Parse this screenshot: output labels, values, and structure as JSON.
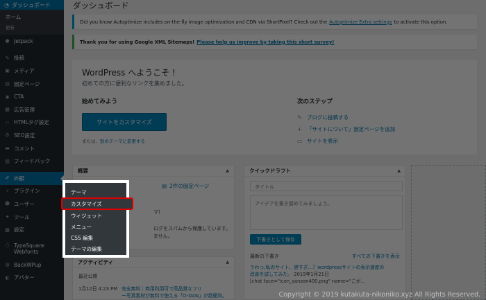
{
  "sidebar": {
    "dashboard": "ダッシュボード",
    "sub": [
      "ホーム",
      "更新"
    ],
    "items": [
      {
        "label": "Jetpack",
        "icon": "jetpack-icon"
      },
      {
        "label": "投稿",
        "icon": "pin-icon"
      },
      {
        "label": "メディア",
        "icon": "media-icon"
      },
      {
        "label": "固定ページ",
        "icon": "page-icon"
      },
      {
        "label": "CTA",
        "icon": "cta-icon"
      },
      {
        "label": "広告管理",
        "icon": "ads-icon"
      },
      {
        "label": "HTMLタグ設定",
        "icon": "code-icon"
      },
      {
        "label": "SEO設定",
        "icon": "seo-icon"
      },
      {
        "label": "コメント",
        "icon": "comment-icon"
      },
      {
        "label": "フィードバック",
        "icon": "feedback-icon"
      }
    ],
    "items2": [
      {
        "label": "外観",
        "icon": "appearance-icon"
      },
      {
        "label": "プラグイン",
        "icon": "plugin-icon"
      },
      {
        "label": "ユーザー",
        "icon": "user-icon"
      },
      {
        "label": "ツール",
        "icon": "tool-icon"
      },
      {
        "label": "設定",
        "icon": "settings-icon"
      }
    ],
    "items3": [
      {
        "label": "TypeSquare Webfonts",
        "icon": "typesquare-icon"
      },
      {
        "label": "BackWPup",
        "icon": "backup-icon"
      },
      {
        "label": "アバター",
        "icon": "avatar-icon"
      }
    ]
  },
  "flyout": [
    "テーマ",
    "カスタマイズ",
    "ウィジェット",
    "メニュー",
    "CSS 編集",
    "テーマの編集"
  ],
  "page_title": "ダッシュボード",
  "notice1": {
    "text": "Did you know Autoptimize includes on-the-fly image optimization and CDN via ShortPixel? Check out the",
    "link": "Autoptimize Extra settings",
    "tail": "to activate this option."
  },
  "notice2": {
    "text": "Thank you for using Google XML Sitemaps!",
    "link": "Please help us improve by taking this short survey!"
  },
  "welcome": {
    "title": "WordPress へようこそ !",
    "subtitle": "初めての方に便利なリンクを集めました。",
    "start_heading": "始めてみよう",
    "customize_button": "サイトをカスタマイズ",
    "alt_prefix": "または、",
    "alt_link": "別のテーマに変更する",
    "next_heading": "次のステップ",
    "next": [
      {
        "label": "ブログに投稿する",
        "icon": "edit-icon"
      },
      {
        "label": "「サイトについて」固定ページを追加",
        "icon": "plus-icon"
      },
      {
        "label": "サイトを表示",
        "icon": "view-icon"
      }
    ]
  },
  "overview": {
    "title": "概要",
    "pages_link": "2件の固定ページ",
    "frag1": "マ)",
    "frag2": "ログをスパムから保護しています。",
    "frag3": "ません。"
  },
  "activity": {
    "title": "アクティビティ",
    "recent": "最近公開",
    "row_date": "1月12日 4:23 PM",
    "row_link1": "完全無料｜商用利用可で高品質なフリ",
    "row_link2": "ー写真素材が無料で使える「O-DAN」が超便利。"
  },
  "quickdraft": {
    "title": "クイックドラフト",
    "title_placeholder": "タイトル",
    "body_placeholder": "アイデアを書き留めてみましょう。",
    "save_button": "下書きとして保存",
    "recent_heading": "最新の下書き",
    "all_link": "すべての下書きを表示",
    "draft_title": "うわっ,私のサイト、遅すぎ…？wordpressサイトの表示速度の",
    "draft_title2": "改善を試してみた。",
    "draft_date": "2019年1月21日",
    "draft_excerpt": "[chat face=\"icon_sanzan400.png\" name=\"こが..."
  },
  "copyright": "Copyright © 2019 kutakuta-nikoniko.xyz All Rights Reserved."
}
